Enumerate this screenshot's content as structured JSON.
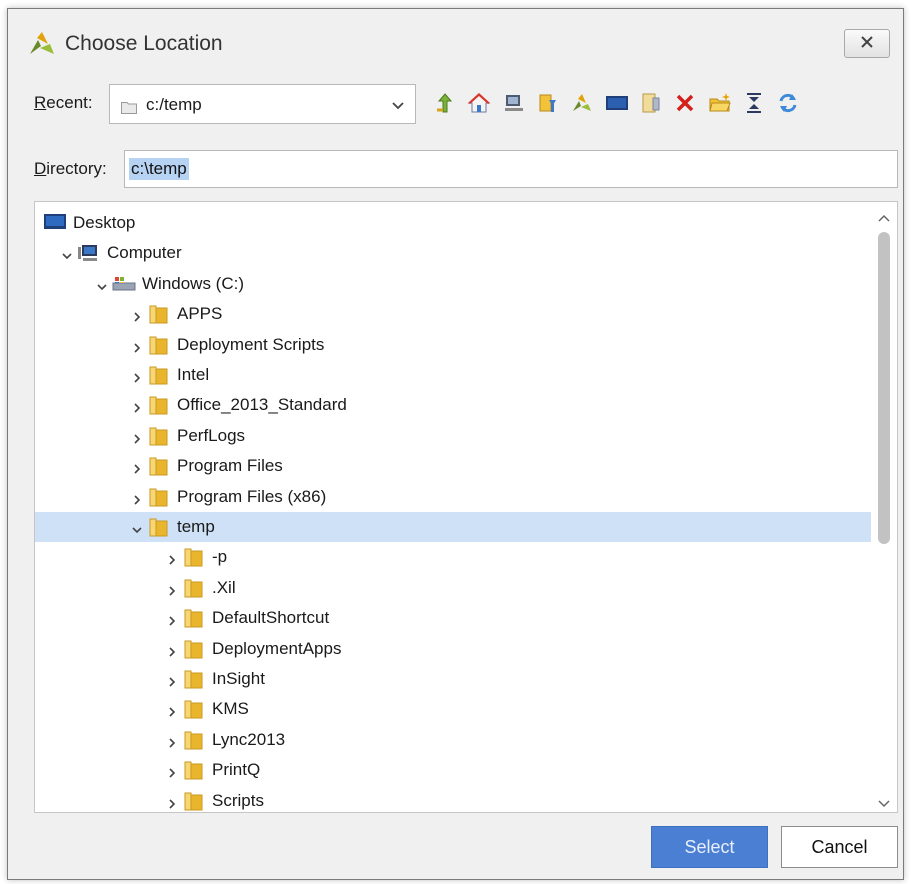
{
  "window": {
    "title": "Choose Location",
    "close_label": "✕"
  },
  "recent": {
    "label": "Recent:",
    "mnemonic": "R",
    "label_rest": "ecent:",
    "value": "c:/temp"
  },
  "toolbar": {
    "buttons": [
      "go-up-icon",
      "home-icon",
      "computer-icon",
      "bookmarks-icon",
      "project-icon",
      "desktop-icon",
      "network-icon",
      "delete-icon",
      "new-folder-icon",
      "collapse-all-icon",
      "refresh-icon"
    ]
  },
  "directory": {
    "label": "Directory:",
    "mnemonic": "D",
    "label_rest": "irectory:",
    "value": "c:\\temp"
  },
  "tree": {
    "items": [
      {
        "label": "Desktop",
        "icon": "desktop-icon",
        "level": 0,
        "expander": "none"
      },
      {
        "label": "Computer",
        "icon": "computer-icon",
        "level": 1,
        "expander": "expanded"
      },
      {
        "label": "Windows (C:)",
        "icon": "drive-icon",
        "level": 2,
        "expander": "expanded"
      },
      {
        "label": "APPS",
        "icon": "folder-icon",
        "level": 3,
        "expander": "collapsed"
      },
      {
        "label": "Deployment Scripts",
        "icon": "folder-icon",
        "level": 3,
        "expander": "collapsed"
      },
      {
        "label": "Intel",
        "icon": "folder-icon",
        "level": 3,
        "expander": "collapsed"
      },
      {
        "label": "Office_2013_Standard",
        "icon": "folder-icon",
        "level": 3,
        "expander": "collapsed"
      },
      {
        "label": "PerfLogs",
        "icon": "folder-icon",
        "level": 3,
        "expander": "collapsed"
      },
      {
        "label": "Program Files",
        "icon": "folder-icon",
        "level": 3,
        "expander": "collapsed"
      },
      {
        "label": "Program Files (x86)",
        "icon": "folder-icon",
        "level": 3,
        "expander": "collapsed"
      },
      {
        "label": "temp",
        "icon": "folder-icon",
        "level": 3,
        "expander": "expanded",
        "selected": true
      },
      {
        "label": "-p",
        "icon": "folder-icon",
        "level": 4,
        "expander": "collapsed"
      },
      {
        "label": ".Xil",
        "icon": "folder-icon",
        "level": 4,
        "expander": "collapsed"
      },
      {
        "label": "DefaultShortcut",
        "icon": "folder-icon",
        "level": 4,
        "expander": "collapsed"
      },
      {
        "label": "DeploymentApps",
        "icon": "folder-icon",
        "level": 4,
        "expander": "collapsed"
      },
      {
        "label": "InSight",
        "icon": "folder-icon",
        "level": 4,
        "expander": "collapsed"
      },
      {
        "label": "KMS",
        "icon": "folder-icon",
        "level": 4,
        "expander": "collapsed"
      },
      {
        "label": "Lync2013",
        "icon": "folder-icon",
        "level": 4,
        "expander": "collapsed"
      },
      {
        "label": "PrintQ",
        "icon": "folder-icon",
        "level": 4,
        "expander": "collapsed"
      },
      {
        "label": "Scripts",
        "icon": "folder-icon",
        "level": 4,
        "expander": "collapsed"
      }
    ]
  },
  "buttons": {
    "select": "Select",
    "cancel": "Cancel"
  },
  "colors": {
    "selection": "#cfe1f7",
    "primary_button": "#4a7fd4",
    "folder": "#f2c23a"
  }
}
